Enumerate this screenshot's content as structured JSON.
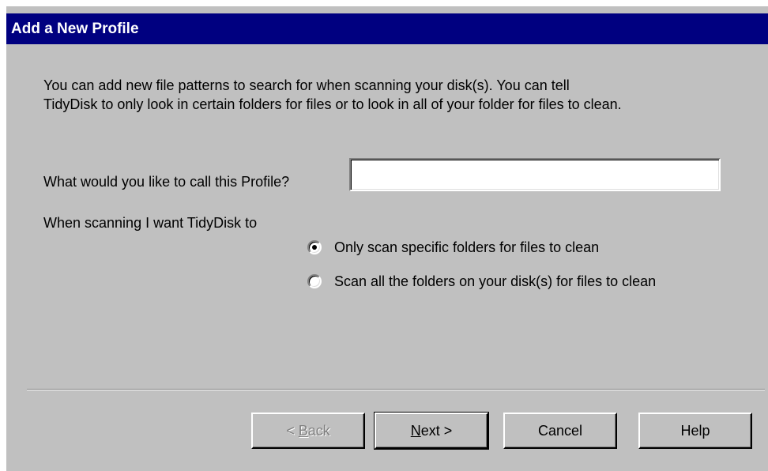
{
  "window": {
    "title": "Add a New Profile"
  },
  "intro": {
    "line1": "You can add new file patterns to search for when scanning your disk(s).  You can tell",
    "line2": "TidyDisk to only look in certain folders for files or to look in all of your folder for files to clean."
  },
  "profile": {
    "label": "What would you like to call this Profile?",
    "value": "",
    "placeholder": ""
  },
  "scan": {
    "label": "When scanning I want TidyDisk to",
    "options": [
      {
        "label": "Only scan specific folders for files to clean",
        "selected": true
      },
      {
        "label": "Scan all the folders on your disk(s) for files to clean",
        "selected": false
      }
    ]
  },
  "buttons": {
    "back": {
      "prefix": "< ",
      "mnemonic": "B",
      "rest": "ack",
      "enabled": false
    },
    "next": {
      "mnemonic": "N",
      "rest": "ext >",
      "enabled": true
    },
    "cancel": {
      "label": "Cancel",
      "enabled": true
    },
    "help": {
      "label": "Help",
      "enabled": true
    }
  },
  "colors": {
    "titlebar": "#000080",
    "face": "#c0c0c0"
  }
}
